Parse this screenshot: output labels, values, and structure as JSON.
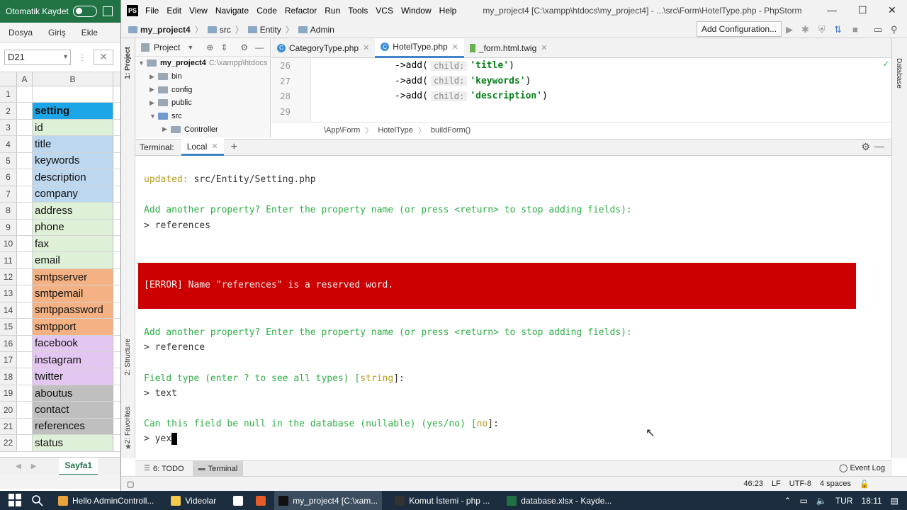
{
  "excel": {
    "autosave_label": "Otomatik Kaydet",
    "ribbon_tabs": [
      "Dosya",
      "Giriş",
      "Ekle"
    ],
    "namebox": "D21",
    "col_headers": [
      "A",
      "B"
    ],
    "rows": [
      {
        "n": "1",
        "b": "",
        "color": "#ffffff",
        "bold": false
      },
      {
        "n": "2",
        "b": "setting",
        "color": "#1ca6e8",
        "bold": true
      },
      {
        "n": "3",
        "b": "id",
        "color": "#dff0d8",
        "bold": false
      },
      {
        "n": "4",
        "b": "title",
        "color": "#bdd7ee",
        "bold": false
      },
      {
        "n": "5",
        "b": "keywords",
        "color": "#bdd7ee",
        "bold": false
      },
      {
        "n": "6",
        "b": "description",
        "color": "#bdd7ee",
        "bold": false
      },
      {
        "n": "7",
        "b": "company",
        "color": "#bdd7ee",
        "bold": false
      },
      {
        "n": "8",
        "b": "address",
        "color": "#dff0d8",
        "bold": false
      },
      {
        "n": "9",
        "b": "phone",
        "color": "#dff0d8",
        "bold": false
      },
      {
        "n": "10",
        "b": "fax",
        "color": "#dff0d8",
        "bold": false
      },
      {
        "n": "11",
        "b": "email",
        "color": "#dff0d8",
        "bold": false
      },
      {
        "n": "12",
        "b": "smtpserver",
        "color": "#f4b183",
        "bold": false
      },
      {
        "n": "13",
        "b": "smtpemail",
        "color": "#f4b183",
        "bold": false
      },
      {
        "n": "14",
        "b": "smtppassword",
        "color": "#f4b183",
        "bold": false
      },
      {
        "n": "15",
        "b": "smtpport",
        "color": "#f4b183",
        "bold": false
      },
      {
        "n": "16",
        "b": "facebook",
        "color": "#e4c7f0",
        "bold": false
      },
      {
        "n": "17",
        "b": "instagram",
        "color": "#e4c7f0",
        "bold": false
      },
      {
        "n": "18",
        "b": "twitter",
        "color": "#e4c7f0",
        "bold": false
      },
      {
        "n": "19",
        "b": "aboutus",
        "color": "#bfbfbf",
        "bold": false
      },
      {
        "n": "20",
        "b": "contact",
        "color": "#bfbfbf",
        "bold": false
      },
      {
        "n": "21",
        "b": "references",
        "color": "#bfbfbf",
        "bold": false
      },
      {
        "n": "22",
        "b": "status",
        "color": "#dff0d8",
        "bold": false
      }
    ],
    "sheet_tab": "Sayfa1"
  },
  "ide": {
    "app_logo": "PS",
    "menu": [
      "File",
      "Edit",
      "View",
      "Navigate",
      "Code",
      "Refactor",
      "Run",
      "Tools",
      "VCS",
      "Window",
      "Help"
    ],
    "window_title": "my_project4 [C:\\xampp\\htdocs\\my_project4] - ...\\src\\Form\\HotelType.php - PhpStorm",
    "breadcrumb": [
      "my_project4",
      "src",
      "Entity",
      "Admin"
    ],
    "add_configuration": "Add Configuration...",
    "project_panel": {
      "label": "Project",
      "strip_label": "1: Project",
      "root": "my_project4",
      "root_path": "C:\\xampp\\htdocs",
      "children": [
        "bin",
        "config",
        "public",
        "src",
        "Controller"
      ]
    },
    "tabs": [
      "CategoryType.php",
      "HotelType.php",
      "_form.html.twig"
    ],
    "code_lines": [
      {
        "n": "26",
        "method": "->add(",
        "hint": "child:",
        "str": "'title'",
        "tail": ")"
      },
      {
        "n": "27",
        "method": "->add(",
        "hint": "child:",
        "str": "'keywords'",
        "tail": ")"
      },
      {
        "n": "28",
        "method": "->add(",
        "hint": "child:",
        "str": "'description'",
        "tail": ")"
      },
      {
        "n": "29",
        "method": "",
        "hint": "",
        "str": "",
        "tail": ""
      }
    ],
    "editor_breadcrumb": [
      "\\App\\Form",
      "HotelType",
      "buildForm()"
    ],
    "right_strip_label": "Database",
    "structure_label": "2: Structure",
    "favorites_label": "2: Favorites",
    "terminal": {
      "label": "Terminal:",
      "tab": "Local",
      "updated_label": "updated:",
      "updated_file": " src/Entity/Setting.php",
      "prompt1": "Add another property? Enter the property name (or press <return> to stop adding fields):",
      "answer1": "> references",
      "error": "[ERROR] Name \"references\" is a reserved word.",
      "prompt2": "Add another property? Enter the property name (or press <return> to stop adding fields):",
      "answer2": "> reference",
      "field_type_prompt": "Field type (enter ? to see all types) [",
      "field_type_default": "string",
      "field_type_end": "]:",
      "answer3": "> text",
      "nullable_prompt": "Can this field be null in the database (nullable) (yes/no) [",
      "nullable_default": "no",
      "nullable_end": "]:",
      "answer4": "> yex"
    },
    "bottom_tabs": [
      "6: TODO",
      "Terminal"
    ],
    "event_log": "Event Log",
    "status": {
      "position": "46:23",
      "line_sep": "LF",
      "encoding": "UTF-8",
      "indent": "4 spaces"
    }
  },
  "taskbar": {
    "items": [
      {
        "label": "Hello AdminControll...",
        "color": "#e8a33d",
        "active": false
      },
      {
        "label": "Videolar",
        "color": "#f2c94c",
        "active": false
      },
      {
        "label": "",
        "color": "#ffffff",
        "active": false
      },
      {
        "label": "",
        "color": "#e55b2a",
        "active": false
      },
      {
        "label": "my_project4 [C:\\xam...",
        "color": "#111111",
        "active": true
      },
      {
        "label": "Komut İstemi - php ...",
        "color": "#333333",
        "active": false
      },
      {
        "label": "database.xlsx - Kayde...",
        "color": "#217346",
        "active": false
      }
    ],
    "lang": "TUR",
    "time": "18:11"
  },
  "colors": {
    "terminal_green": "#2fae46",
    "error_red": "#cc0000",
    "string_green": "#067d17",
    "excel_green": "#217346",
    "taskbar": "#1b2d3f"
  }
}
